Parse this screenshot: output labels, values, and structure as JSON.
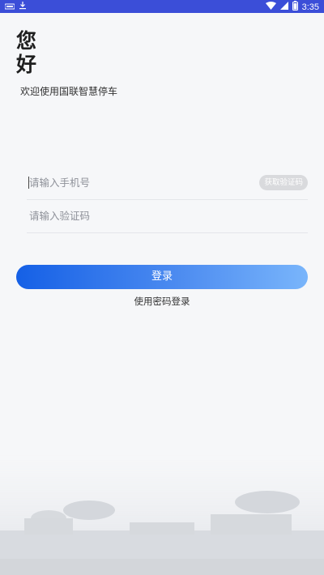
{
  "status_bar": {
    "time": "3:35",
    "icons": [
      "notification-icon",
      "download-icon",
      "wifi-icon",
      "signal-icon",
      "battery-icon"
    ]
  },
  "greeting": {
    "title": "您好",
    "subtitle": "欢迎使用国联智慧停车"
  },
  "form": {
    "phone_placeholder": "请输入手机号",
    "code_placeholder": "请输入验证码",
    "get_code_label": "获取验证码"
  },
  "actions": {
    "login_label": "登录",
    "password_login_label": "使用密码登录"
  },
  "colors": {
    "status_bar": "#3b4ed8",
    "primary_start": "#1560e6",
    "primary_end": "#79b5fb",
    "background": "#f6f7f9"
  }
}
